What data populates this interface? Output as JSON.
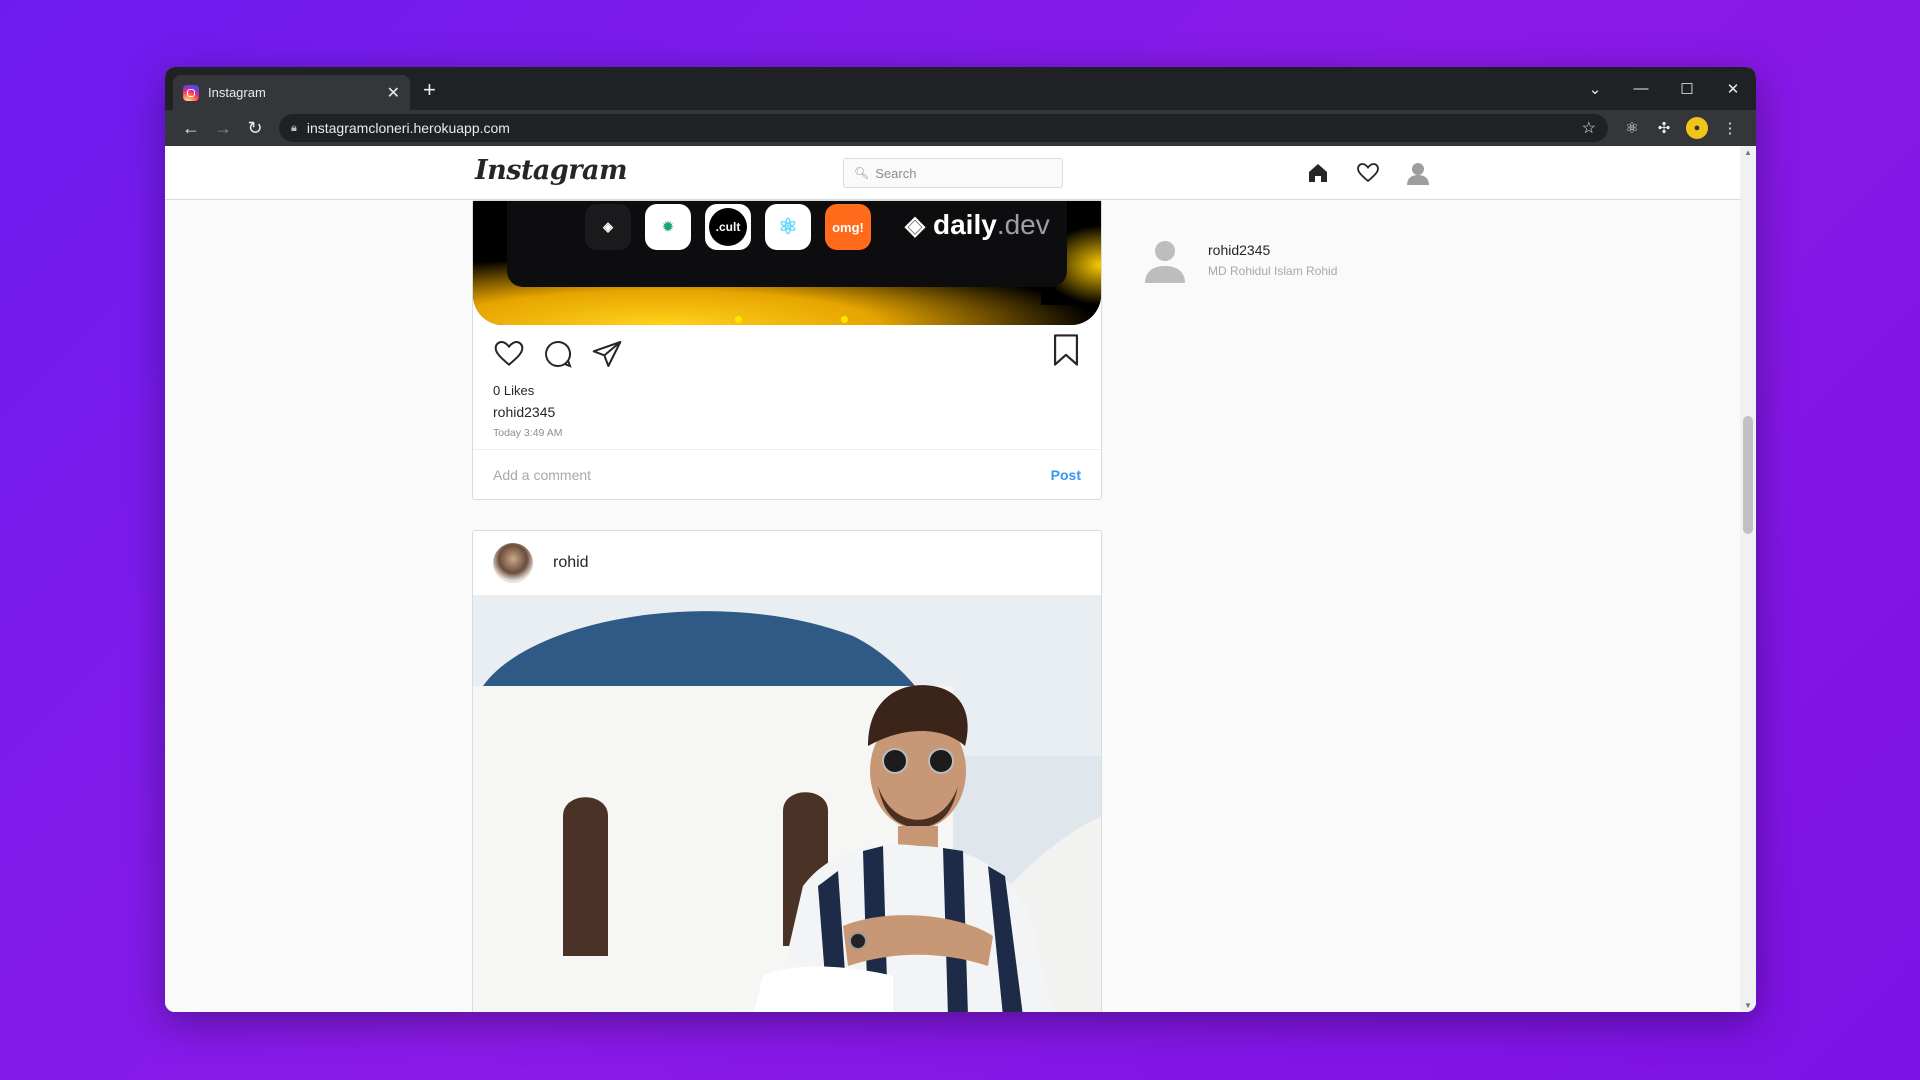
{
  "browser": {
    "tab_title": "Instagram",
    "new_tab_label": "+",
    "url": "instagramcloneri.herokuapp.com",
    "window_controls": [
      "⌄",
      "—",
      "☐",
      "✕"
    ]
  },
  "header": {
    "logo_text": "Instagram",
    "search_placeholder": "Search",
    "nav_icons": [
      "home-icon",
      "heart-icon",
      "profile-icon"
    ]
  },
  "post1": {
    "promo_brand": "daily",
    "promo_brand_suffix": ".dev",
    "promo_apps": [
      "daily",
      "gear",
      ".cult",
      "react",
      "omg!"
    ],
    "likes": "0 Likes",
    "author": "rohid2345",
    "time": "Today 3:49 AM",
    "comment_placeholder": "Add a comment",
    "post_button": "Post"
  },
  "post2": {
    "username": "rohid"
  },
  "sidebar": {
    "username": "rohid2345",
    "full_name": "MD Rohidul Islam Rohid"
  },
  "colors": {
    "background": "#7c12e6",
    "accent_blue": "#3897f0",
    "promo_yellow": "#ffd21a"
  }
}
